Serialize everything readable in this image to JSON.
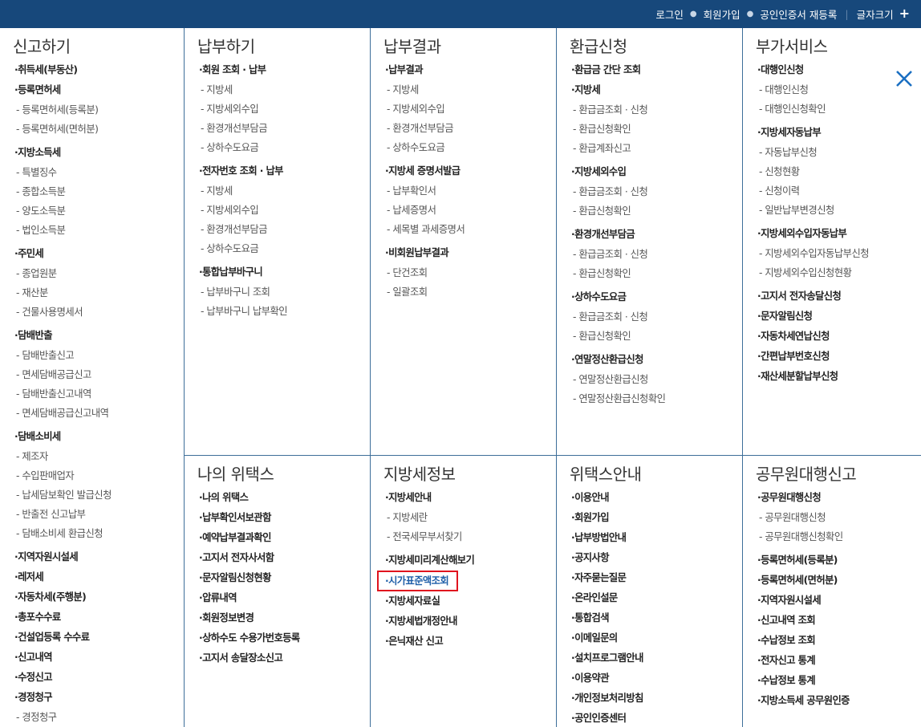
{
  "header": {
    "login": "로그인",
    "join": "회원가입",
    "cert": "공인인증서 재등록",
    "font_size": "글자크기",
    "plus": "+"
  },
  "close_label": "닫기",
  "sections": {
    "report": {
      "title": "신고하기",
      "items": [
        {
          "type": "main",
          "text": "·취득세(부동산)"
        },
        {
          "type": "main",
          "text": "·등록면허세"
        },
        {
          "type": "sub",
          "text": "- 등록면허세(등록분)"
        },
        {
          "type": "sub",
          "text": "- 등록면허세(면허분)",
          "last": true
        },
        {
          "type": "main",
          "text": "·지방소득세",
          "gap": true
        },
        {
          "type": "sub",
          "text": "- 특별징수"
        },
        {
          "type": "sub",
          "text": "- 종합소득분"
        },
        {
          "type": "sub",
          "text": "- 양도소득분"
        },
        {
          "type": "sub",
          "text": "- 법인소득분",
          "last": true
        },
        {
          "type": "main",
          "text": "·주민세",
          "gap": true
        },
        {
          "type": "sub",
          "text": "- 종업원분"
        },
        {
          "type": "sub",
          "text": "- 재산분"
        },
        {
          "type": "sub",
          "text": "- 건물사용명세서",
          "last": true
        },
        {
          "type": "main",
          "text": "·담배반출",
          "gap": true
        },
        {
          "type": "sub",
          "text": "- 담배반출신고"
        },
        {
          "type": "sub",
          "text": "- 면세담배공급신고"
        },
        {
          "type": "sub",
          "text": "- 담배반출신고내역"
        },
        {
          "type": "sub",
          "text": "- 면세담배공급신고내역",
          "last": true
        },
        {
          "type": "main",
          "text": "·담배소비세",
          "gap": true
        },
        {
          "type": "sub",
          "text": "- 제조자"
        },
        {
          "type": "sub",
          "text": "- 수입판매업자"
        },
        {
          "type": "sub",
          "text": "- 납세담보확인 발급신청"
        },
        {
          "type": "sub",
          "text": "- 반출전 신고납부"
        },
        {
          "type": "sub",
          "text": "- 담배소비세 환급신청",
          "last": true
        },
        {
          "type": "main",
          "text": "·지역자원시설세",
          "gap": true
        },
        {
          "type": "main",
          "text": "·레저세"
        },
        {
          "type": "main",
          "text": "·자동차세(주행분)"
        },
        {
          "type": "main",
          "text": "·총포수수료"
        },
        {
          "type": "main",
          "text": "·건설업등록 수수료"
        },
        {
          "type": "main",
          "text": "·신고내역"
        },
        {
          "type": "main",
          "text": "·수정신고"
        },
        {
          "type": "main",
          "text": "·경정청구"
        },
        {
          "type": "sub",
          "text": "- 경정청구"
        }
      ]
    },
    "payment": {
      "title": "납부하기",
      "items": [
        {
          "type": "main",
          "text": "·회원 조회 · 납부"
        },
        {
          "type": "sub",
          "text": "- 지방세"
        },
        {
          "type": "sub",
          "text": "- 지방세외수입"
        },
        {
          "type": "sub",
          "text": "- 환경개선부담금"
        },
        {
          "type": "sub",
          "text": "- 상하수도요금",
          "last": true
        },
        {
          "type": "main",
          "text": "·전자번호 조회 · 납부",
          "gap": true
        },
        {
          "type": "sub",
          "text": "- 지방세"
        },
        {
          "type": "sub",
          "text": "- 지방세외수입"
        },
        {
          "type": "sub",
          "text": "- 환경개선부담금"
        },
        {
          "type": "sub",
          "text": "- 상하수도요금",
          "last": true
        },
        {
          "type": "main",
          "text": "·통합납부바구니",
          "gap": true
        },
        {
          "type": "sub",
          "text": "- 납부바구니 조회"
        },
        {
          "type": "sub",
          "text": "- 납부바구니 납부확인"
        }
      ]
    },
    "result": {
      "title": "납부결과",
      "items": [
        {
          "type": "main",
          "text": "·납부결과"
        },
        {
          "type": "sub",
          "text": "- 지방세"
        },
        {
          "type": "sub",
          "text": "- 지방세외수입"
        },
        {
          "type": "sub",
          "text": "- 환경개선부담금"
        },
        {
          "type": "sub",
          "text": "- 상하수도요금",
          "last": true
        },
        {
          "type": "main",
          "text": "·지방세 증명서발급",
          "gap": true
        },
        {
          "type": "sub",
          "text": "- 납부확인서"
        },
        {
          "type": "sub",
          "text": "- 납세증명서"
        },
        {
          "type": "sub",
          "text": "- 세목별 과세증명서",
          "last": true
        },
        {
          "type": "main",
          "text": "·비회원납부결과",
          "gap": true
        },
        {
          "type": "sub",
          "text": "- 단건조회"
        },
        {
          "type": "sub",
          "text": "- 일괄조회"
        }
      ]
    },
    "refund": {
      "title": "환급신청",
      "items": [
        {
          "type": "main",
          "text": "·환급금 간단 조회"
        },
        {
          "type": "main",
          "text": "·지방세"
        },
        {
          "type": "sub",
          "text": "- 환급금조회 · 신청"
        },
        {
          "type": "sub",
          "text": "- 환급신청확인"
        },
        {
          "type": "sub",
          "text": "- 환급계좌신고",
          "last": true
        },
        {
          "type": "main",
          "text": "·지방세외수입",
          "gap": true
        },
        {
          "type": "sub",
          "text": "- 환급금조회 · 신청"
        },
        {
          "type": "sub",
          "text": "- 환급신청확인",
          "last": true
        },
        {
          "type": "main",
          "text": "·환경개선부담금",
          "gap": true
        },
        {
          "type": "sub",
          "text": "- 환급금조회 · 신청"
        },
        {
          "type": "sub",
          "text": "- 환급신청확인",
          "last": true
        },
        {
          "type": "main",
          "text": "·상하수도요금",
          "gap": true
        },
        {
          "type": "sub",
          "text": "- 환급금조회 · 신청"
        },
        {
          "type": "sub",
          "text": "- 환급신청확인",
          "last": true
        },
        {
          "type": "main",
          "text": "·연말정산환급신청",
          "gap": true
        },
        {
          "type": "sub",
          "text": "- 연말정산환급신청"
        },
        {
          "type": "sub",
          "text": "- 연말정산환급신청확인"
        }
      ]
    },
    "extra": {
      "title": "부가서비스",
      "items": [
        {
          "type": "main",
          "text": "·대행인신청"
        },
        {
          "type": "sub",
          "text": "- 대행인신청"
        },
        {
          "type": "sub",
          "text": "- 대행인신청확인",
          "last": true
        },
        {
          "type": "main",
          "text": "·지방세자동납부",
          "gap": true
        },
        {
          "type": "sub",
          "text": "- 자동납부신청"
        },
        {
          "type": "sub",
          "text": "- 신청현황"
        },
        {
          "type": "sub",
          "text": "- 신청이력"
        },
        {
          "type": "sub",
          "text": "- 일반납부변경신청",
          "last": true
        },
        {
          "type": "main",
          "text": "·지방세외수입자동납부",
          "gap": true
        },
        {
          "type": "sub",
          "text": "- 지방세외수입자동납부신청"
        },
        {
          "type": "sub",
          "text": "- 지방세외수입신청현황",
          "last": true
        },
        {
          "type": "main",
          "text": "·고지서 전자송달신청",
          "gap": true
        },
        {
          "type": "main",
          "text": "·문자알림신청"
        },
        {
          "type": "main",
          "text": "·자동차세연납신청"
        },
        {
          "type": "main",
          "text": "·간편납부번호신청"
        },
        {
          "type": "main",
          "text": "·재산세분할납부신청"
        }
      ]
    },
    "mywetax": {
      "title": "나의 위택스",
      "items": [
        {
          "type": "main",
          "text": "·나의 위택스"
        },
        {
          "type": "main",
          "text": "·납부확인서보관함"
        },
        {
          "type": "main",
          "text": "·예약납부결과확인"
        },
        {
          "type": "main",
          "text": "·고지서 전자사서함"
        },
        {
          "type": "main",
          "text": "·문자알림신청현황"
        },
        {
          "type": "main",
          "text": "·압류내역"
        },
        {
          "type": "main",
          "text": "·회원정보변경"
        },
        {
          "type": "main",
          "text": "·상하수도 수용가번호등록"
        },
        {
          "type": "main",
          "text": "·고지서 송달장소신고"
        }
      ]
    },
    "taxinfo": {
      "title": "지방세정보",
      "items": [
        {
          "type": "main",
          "text": "·지방세안내"
        },
        {
          "type": "sub",
          "text": "- 지방세란"
        },
        {
          "type": "sub",
          "text": "- 전국세무부서찾기",
          "last": true
        },
        {
          "type": "main",
          "text": "·지방세미리계산해보기",
          "gap": true
        },
        {
          "type": "main",
          "text": "·시가표준액조회",
          "highlight": true
        },
        {
          "type": "main",
          "text": "·지방세자료실"
        },
        {
          "type": "main",
          "text": "·지방세법개정안내"
        },
        {
          "type": "main",
          "text": "·은닉재산 신고"
        }
      ]
    },
    "guide": {
      "title": "위택스안내",
      "items": [
        {
          "type": "main",
          "text": "·이용안내"
        },
        {
          "type": "main",
          "text": "·회원가입"
        },
        {
          "type": "main",
          "text": "·납부방법안내"
        },
        {
          "type": "main",
          "text": "·공지사항"
        },
        {
          "type": "main",
          "text": "·자주묻는질문"
        },
        {
          "type": "main",
          "text": "·온라인설문"
        },
        {
          "type": "main",
          "text": "·통합검색"
        },
        {
          "type": "main",
          "text": "·이메일문의"
        },
        {
          "type": "main",
          "text": "·설치프로그램안내"
        },
        {
          "type": "main",
          "text": "·이용약관"
        },
        {
          "type": "main",
          "text": "·개인정보처리방침"
        },
        {
          "type": "main",
          "text": "·공인인증센터"
        }
      ]
    },
    "official": {
      "title": "공무원대행신고",
      "items": [
        {
          "type": "main",
          "text": "·공무원대행신청"
        },
        {
          "type": "sub",
          "text": "- 공무원대행신청"
        },
        {
          "type": "sub",
          "text": "- 공무원대행신청확인",
          "last": true
        },
        {
          "type": "main",
          "text": "·등록면허세(등록분)",
          "gap": true
        },
        {
          "type": "main",
          "text": "·등록면허세(면허분)"
        },
        {
          "type": "main",
          "text": "·지역자원시설세"
        },
        {
          "type": "main",
          "text": "·신고내역 조회"
        },
        {
          "type": "main",
          "text": "·수납정보 조회"
        },
        {
          "type": "main",
          "text": "·전자신고 통계"
        },
        {
          "type": "main",
          "text": "·수납정보 통계"
        },
        {
          "type": "main",
          "text": "·지방소득세 공무원인증"
        }
      ]
    }
  }
}
